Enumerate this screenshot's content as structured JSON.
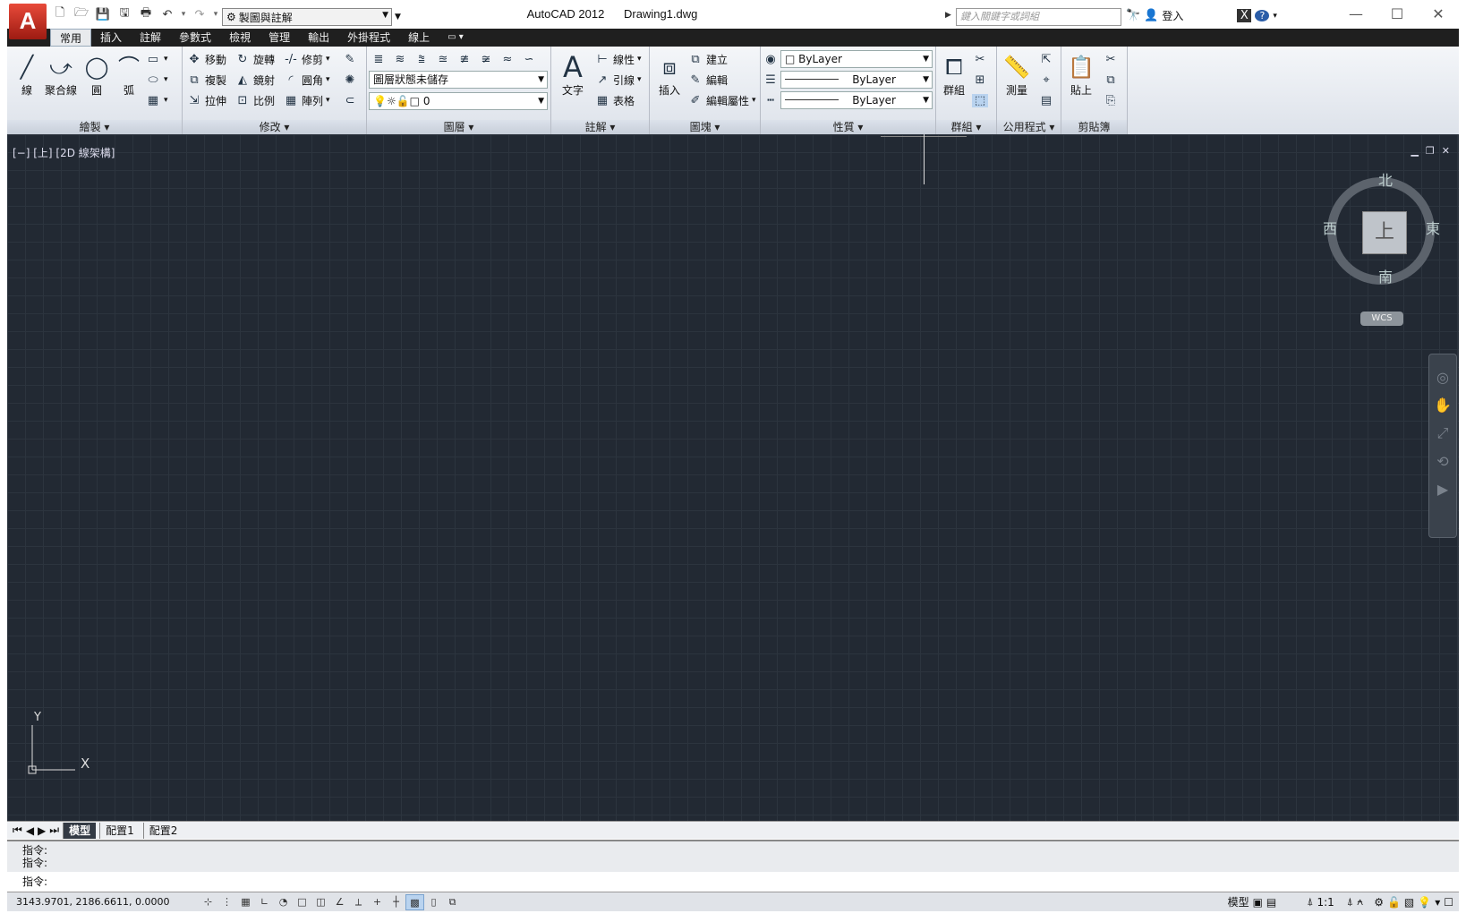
{
  "app": {
    "logo": "A",
    "title": "AutoCAD 2012      Drawing1.dwg",
    "workspace": "製圖與註解",
    "search_placeholder": "鍵入關鍵字或詞組",
    "login": "登入"
  },
  "qat": {
    "icons": [
      "new-icon",
      "open-icon",
      "save-icon",
      "saveas-icon",
      "print-icon",
      "undo-icon",
      "redo-icon"
    ]
  },
  "tabs": [
    "常用",
    "插入",
    "註解",
    "參數式",
    "檢視",
    "管理",
    "輸出",
    "外掛程式",
    "線上"
  ],
  "ribbon": {
    "draw": {
      "title": "繪製 ▾",
      "line": "線",
      "polyline": "聚合線",
      "circle": "圓",
      "arc": "弧"
    },
    "modify": {
      "title": "修改 ▾",
      "move": "移動",
      "rotate": "旋轉",
      "trim": "修剪",
      "copy": "複製",
      "mirror": "鏡射",
      "fillet": "圓角",
      "stretch": "拉伸",
      "scale": "比例",
      "array": "陣列"
    },
    "layers": {
      "title": "圖層 ▾",
      "state": "圖層狀態未儲存",
      "current": "0"
    },
    "annotation": {
      "title": "註解 ▾",
      "text": "文字",
      "dimension": "線性",
      "leader": "引線",
      "table": "表格"
    },
    "block": {
      "title": "圖塊 ▾",
      "insert": "插入",
      "create": "建立",
      "edit": "編輯",
      "edit_attr": "編輯屬性"
    },
    "properties": {
      "title": "性質 ▾",
      "color": "ByLayer",
      "lineweight": "ByLayer",
      "linetype": "ByLayer"
    },
    "groups": {
      "title": "群組 ▾",
      "group": "群組"
    },
    "utilities": {
      "title": "公用程式 ▾",
      "measure": "測量"
    },
    "clipboard": {
      "title": "剪貼簿",
      "paste": "貼上"
    }
  },
  "viewport": {
    "label": "[−] [上] [2D 線架構]",
    "viewcube": {
      "north": "北",
      "south": "南",
      "east": "東",
      "west": "西",
      "face": "上"
    },
    "wcs": "WCS",
    "ucs_x": "X",
    "ucs_y": "Y"
  },
  "layout_tabs": [
    "模型",
    "配置1",
    "配置2"
  ],
  "command": {
    "history": [
      "指令:",
      "指令:"
    ],
    "prompt": "指令:"
  },
  "status": {
    "coords": "3143.9701,  2186.6611,  0.0000",
    "model": "模型",
    "scale": "1:1"
  }
}
